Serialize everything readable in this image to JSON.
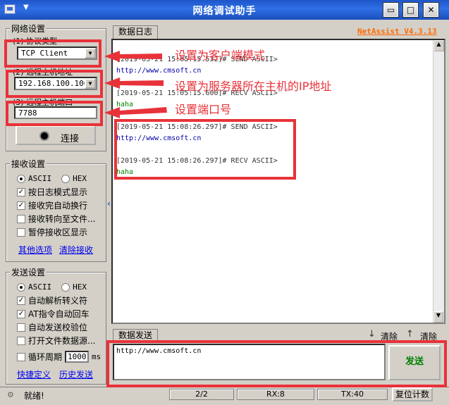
{
  "window": {
    "title": "网络调试助手",
    "version": "NetAssist V4.3.13"
  },
  "network": {
    "group_title": "网络设置",
    "protocol_label": "(1) 协议类型",
    "protocol_value": "TCP Client",
    "host_label": "(2) 远程主机地址",
    "host_value": "192.168.100.106",
    "port_label": "(3) 远程主机端口",
    "port_value": "7788",
    "connect_label": "连接"
  },
  "receive": {
    "group_title": "接收设置",
    "ascii": "ASCII",
    "hex": "HEX",
    "options": [
      "按日志模式显示",
      "接收完自动换行",
      "接收转向至文件...",
      "暂停接收区显示"
    ],
    "checked": [
      true,
      true,
      false,
      false
    ],
    "more_link": "其他选项",
    "clear_link": "清除接收"
  },
  "send_settings": {
    "group_title": "发送设置",
    "ascii": "ASCII",
    "hex": "HEX",
    "options": [
      "自动解析转义符",
      "AT指令自动回车",
      "自动发送校验位",
      "打开文件数据源..."
    ],
    "checked": [
      true,
      true,
      false,
      false
    ],
    "loop_label": "循环周期",
    "loop_value": "1000",
    "loop_unit": "ms",
    "shortcut_link": "快捷定义",
    "history_link": "历史发送"
  },
  "log": {
    "tab": "数据日志",
    "entries": [
      {
        "header": "[2019-05-21 15:05:15.532]# SEND ASCII>",
        "body": "http://www.cmsoft.cn",
        "color": "#0000aa"
      },
      {
        "header": "[2019-05-21 15:05:15.600]# RECV ASCII>",
        "body": "haha",
        "color": "#008000"
      },
      {
        "header": "[2019-05-21 15:08:26.297]# SEND ASCII>",
        "body": "http://www.cmsoft.cn",
        "color": "#0000aa"
      },
      {
        "header": "[2019-05-21 15:08:26.297]# RECV ASCII>",
        "body": "haha",
        "color": "#008000"
      }
    ]
  },
  "send_area": {
    "tab": "数据发送",
    "clear1": "清除",
    "clear2": "清除",
    "text": "http://www.cmsoft.cn",
    "send_button": "发送"
  },
  "status": {
    "ready": "就绪!",
    "pages": "2/2",
    "rx": "RX:8",
    "tx": "TX:40",
    "reset": "复位计数"
  },
  "annotations": {
    "client_mode": "设置为客户端模式",
    "server_ip": "设置为服务器所在主机的IP地址",
    "port": "设置端口号"
  },
  "colors": {
    "accent_red": "#e8323a",
    "title_blue": "#1e56c9",
    "send_green": "#008000"
  }
}
